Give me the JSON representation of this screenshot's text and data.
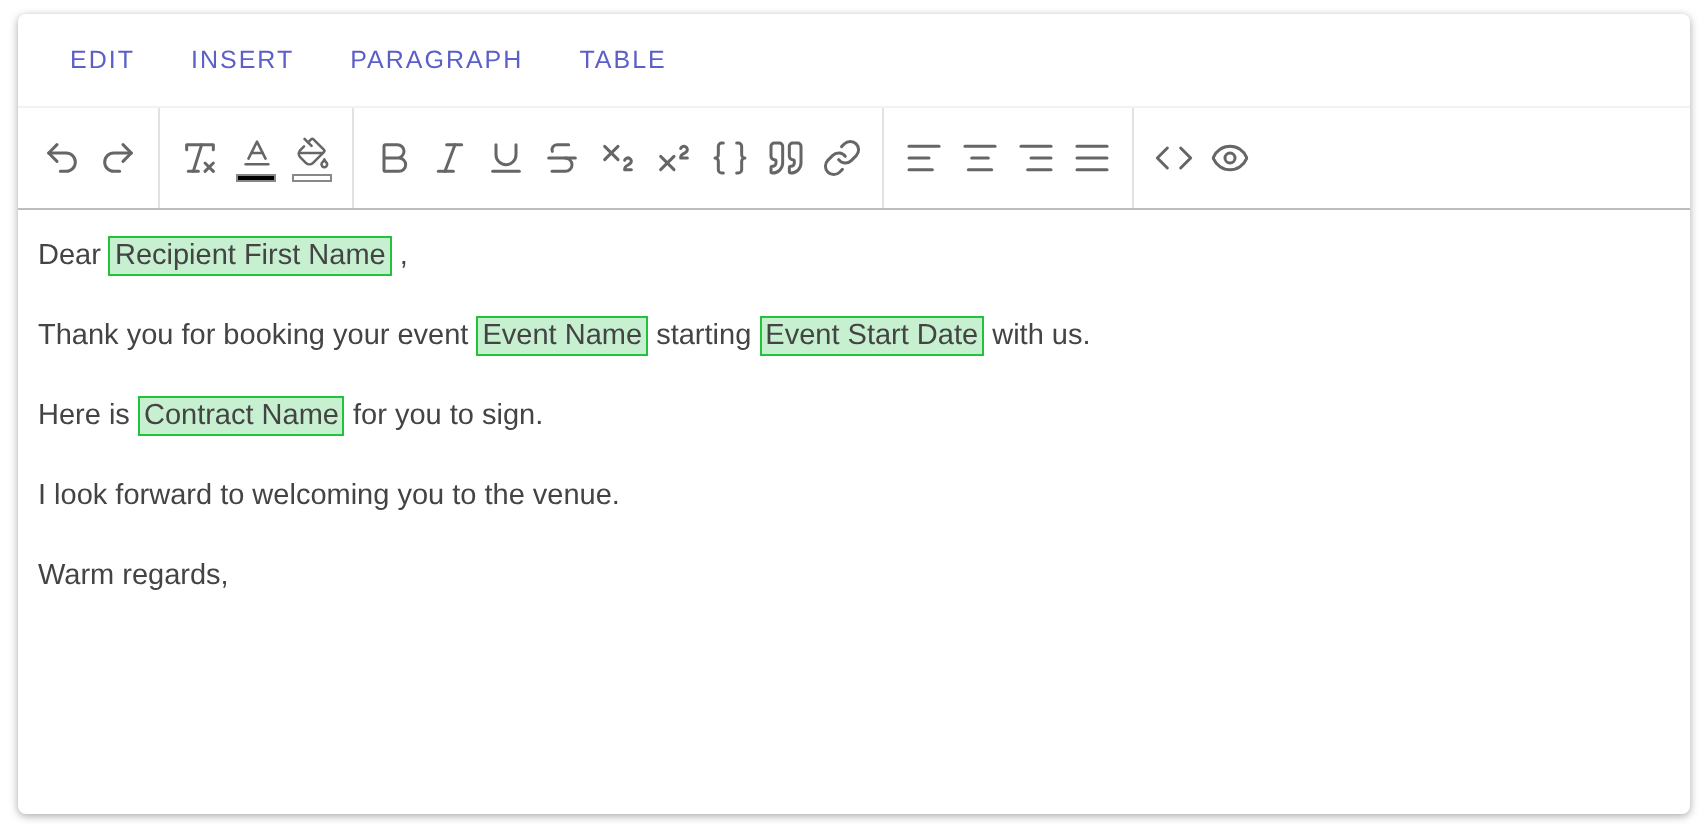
{
  "menu": [
    {
      "label": "EDIT"
    },
    {
      "label": "INSERT"
    },
    {
      "label": "PARAGRAPH"
    },
    {
      "label": "TABLE"
    }
  ],
  "toolbar": [
    [
      {
        "kind": "undo"
      },
      {
        "kind": "redo"
      }
    ],
    [
      {
        "kind": "clear_format"
      },
      {
        "kind": "text_color",
        "color": "#000000"
      },
      {
        "kind": "fill_color",
        "color": "#ffffff"
      }
    ],
    [
      {
        "kind": "bold"
      },
      {
        "kind": "italic"
      },
      {
        "kind": "underline"
      },
      {
        "kind": "strike"
      },
      {
        "kind": "subscript"
      },
      {
        "kind": "superscript"
      },
      {
        "kind": "variable"
      },
      {
        "kind": "quote"
      },
      {
        "kind": "link"
      }
    ],
    [
      {
        "kind": "align_left"
      },
      {
        "kind": "align_center"
      },
      {
        "kind": "align_right"
      },
      {
        "kind": "align_justify"
      }
    ],
    [
      {
        "kind": "code"
      },
      {
        "kind": "preview"
      }
    ]
  ],
  "paragraphs": [
    [
      {
        "kind": "text",
        "text": "Dear"
      },
      {
        "kind": "field",
        "text": "Recipient First Name"
      },
      {
        "kind": "text",
        "text": ","
      }
    ],
    [
      {
        "kind": "text",
        "text": "Thank you for booking your event"
      },
      {
        "kind": "field",
        "text": "Event Name"
      },
      {
        "kind": "text",
        "text": "starting"
      },
      {
        "kind": "field",
        "text": "Event Start Date"
      },
      {
        "kind": "text",
        "text": "with us."
      }
    ],
    [
      {
        "kind": "text",
        "text": "Here is"
      },
      {
        "kind": "field",
        "text": "Contract Name"
      },
      {
        "kind": "text",
        "text": "for you to sign."
      }
    ],
    [
      {
        "kind": "text",
        "text": "I look forward to welcoming you to the venue."
      }
    ],
    [
      {
        "kind": "text",
        "text": "Warm regards,"
      }
    ]
  ]
}
